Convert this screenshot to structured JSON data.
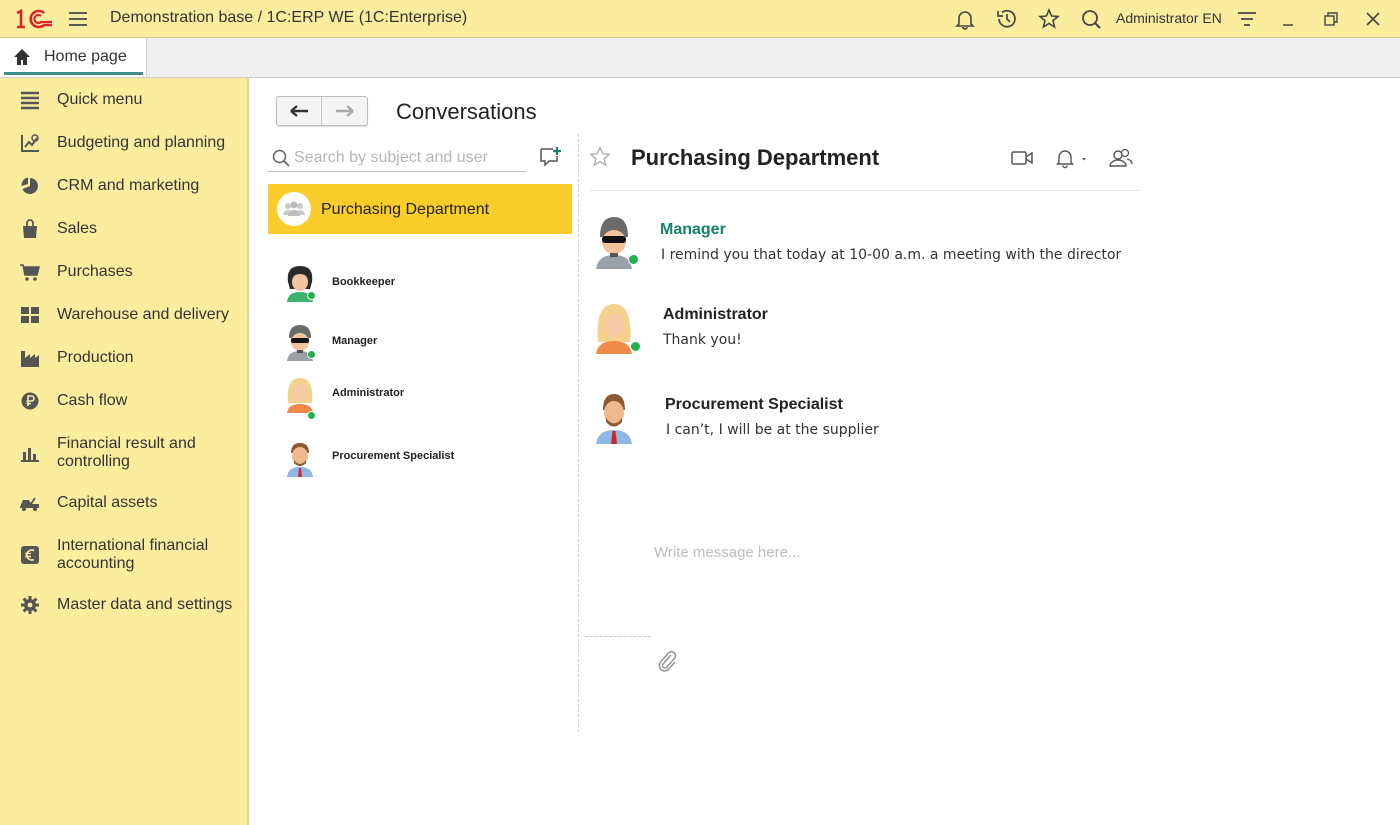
{
  "titlebar": {
    "app_title": "Demonstration base / 1C:ERP WE  (1C:Enterprise)",
    "user_label": "Administrator EN",
    "icons": [
      "1c-logo-icon",
      "menu-icon",
      "bell-icon",
      "history-icon",
      "star-icon",
      "search-icon",
      "filter-icon",
      "minimize-icon",
      "restore-icon",
      "close-icon"
    ],
    "brand_color": "#d6262b"
  },
  "tabs": [
    {
      "label": "Home page",
      "icon": "home-icon",
      "active": true
    }
  ],
  "sidebar": {
    "items": [
      {
        "label": "Quick menu",
        "icon": "list-icon"
      },
      {
        "label": "Budgeting and planning",
        "icon": "budget-icon"
      },
      {
        "label": "CRM and marketing",
        "icon": "pie-icon"
      },
      {
        "label": "Sales",
        "icon": "bag-icon"
      },
      {
        "label": "Purchases",
        "icon": "cart-icon"
      },
      {
        "label": "Warehouse and delivery",
        "icon": "grid-icon"
      },
      {
        "label": "Production",
        "icon": "factory-icon"
      },
      {
        "label": "Cash flow",
        "icon": "ruble-icon"
      },
      {
        "label": "Financial result and controlling",
        "icon": "bar-chart-icon"
      },
      {
        "label": "Capital assets",
        "icon": "truck-icon"
      },
      {
        "label": "International financial accounting",
        "icon": "euro-icon"
      },
      {
        "label": "Master data and settings",
        "icon": "gear-icon"
      }
    ]
  },
  "page": {
    "title": "Conversations"
  },
  "conversations": {
    "search_placeholder": "Search by subject and user",
    "active": {
      "label": "Purchasing Department",
      "icon": "group-icon"
    },
    "members": [
      {
        "name": "Bookkeeper",
        "online": true
      },
      {
        "name": "Manager",
        "online": true
      },
      {
        "name": "Administrator",
        "online": true
      },
      {
        "name": "Procurement Specialist",
        "online": false
      }
    ]
  },
  "chat": {
    "title": "Purchasing Department",
    "messages": [
      {
        "author": "Manager",
        "text": "I remind you that today at 10-00 a.m. a meeting with the director",
        "online": true,
        "accent": true
      },
      {
        "author": "Administrator",
        "text": "Thank you!",
        "online": true,
        "accent": false
      },
      {
        "author": "Procurement Specialist",
        "text": "I can’t, I will be at the supplier",
        "online": false,
        "accent": false
      }
    ],
    "input_placeholder": "Write message here...",
    "accent_color": "#16826a",
    "highlight_color": "#fbcd2a",
    "online_color": "#22b14c"
  }
}
